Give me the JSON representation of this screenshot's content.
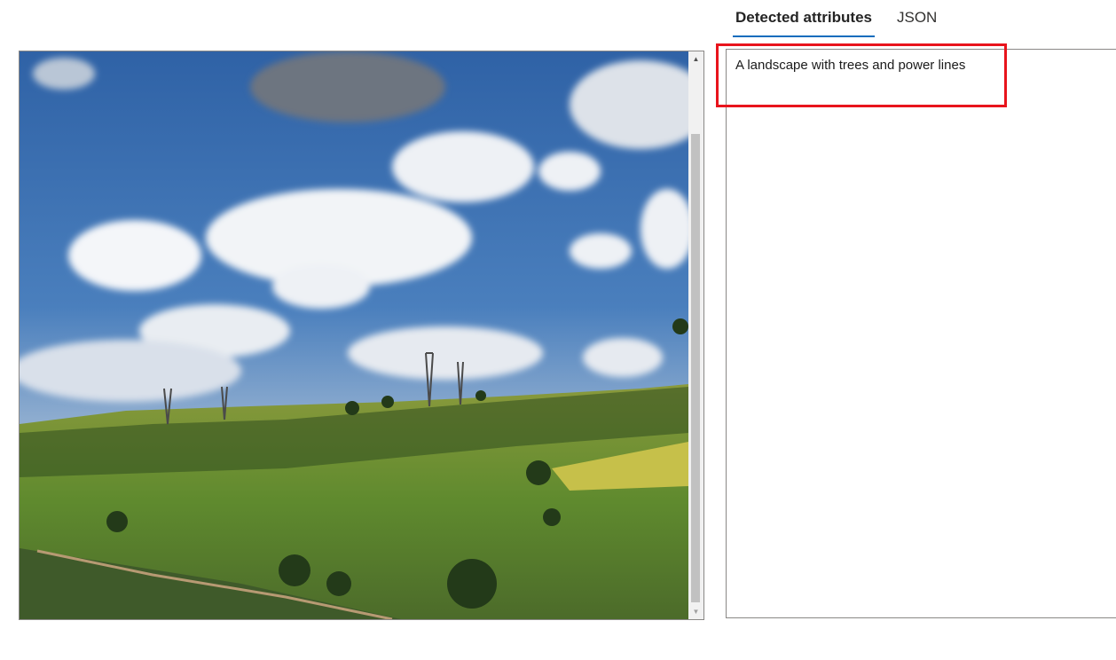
{
  "tabs": [
    {
      "label": "Detected attributes",
      "active": true
    },
    {
      "label": "JSON",
      "active": false
    }
  ],
  "result": {
    "caption": "A landscape with trees and power lines"
  },
  "colors": {
    "active_tab_underline": "#0f6cbd",
    "highlight_border": "#e8141c",
    "sky": "#3b6fae",
    "grass": "#6f8f3a"
  },
  "image": {
    "scrollbar": {
      "up": "▲",
      "down": "▼"
    }
  }
}
